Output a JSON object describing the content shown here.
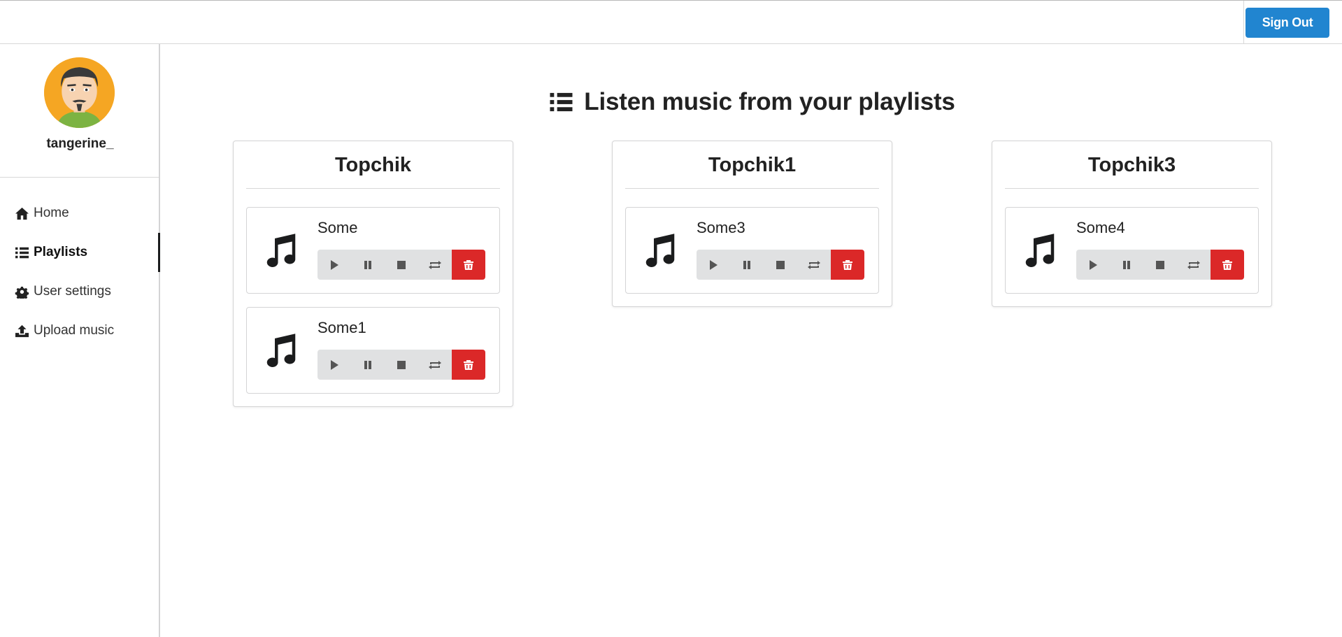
{
  "header": {
    "signout_label": "Sign Out"
  },
  "sidebar": {
    "username": "tangerine_",
    "items": [
      {
        "label": "Home",
        "icon": "home-icon"
      },
      {
        "label": "Playlists",
        "icon": "list-icon",
        "active": true
      },
      {
        "label": "User settings",
        "icon": "gear-icon"
      },
      {
        "label": "Upload music",
        "icon": "upload-icon"
      }
    ]
  },
  "main": {
    "title": "Listen music from your playlists",
    "playlists": [
      {
        "name": "Topchik",
        "songs": [
          {
            "name": "Some"
          },
          {
            "name": "Some1"
          }
        ]
      },
      {
        "name": "Topchik1",
        "songs": [
          {
            "name": "Some3"
          }
        ]
      },
      {
        "name": "Topchik3",
        "songs": [
          {
            "name": "Some4"
          }
        ]
      }
    ]
  },
  "colors": {
    "primary": "#2185d0",
    "danger": "#db2828",
    "control_bg": "#e0e1e2",
    "avatar_bg": "#f5a623"
  }
}
